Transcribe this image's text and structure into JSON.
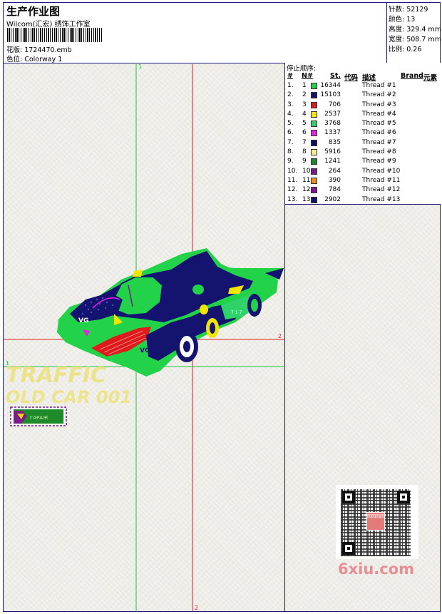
{
  "header": {
    "title": "生产作业图",
    "subtitle": "Wilcom(汇宏) 绣饰工作室",
    "design_line": "花版:  1724470.emb",
    "colorway_line": "色位:  Colorway 1"
  },
  "specs": {
    "stitches": "针数: 52129",
    "colors": "颜色: 13",
    "height": "高度: 329.4 mm",
    "width": "宽度: 508.7 mm",
    "scale": "比例: 0.26"
  },
  "stop_panel": {
    "title": "停止顺序:",
    "headers": {
      "stop": "#",
      "n": "N#",
      "st": "St.",
      "code": "代码",
      "desc": "描述",
      "brand": "Brand",
      "elem": "元素"
    },
    "rows": [
      {
        "stop": "1.",
        "n": "1",
        "color": "#22d34a",
        "st": "16344",
        "desc": "Thread #1"
      },
      {
        "stop": "2.",
        "n": "2",
        "color": "#141470",
        "st": "15103",
        "desc": "Thread #2"
      },
      {
        "stop": "3.",
        "n": "3",
        "color": "#e01a1a",
        "st": "706",
        "desc": "Thread #3"
      },
      {
        "stop": "4.",
        "n": "4",
        "color": "#f2e600",
        "st": "2537",
        "desc": "Thread #4"
      },
      {
        "stop": "5.",
        "n": "5",
        "color": "#2fd36a",
        "st": "3768",
        "desc": "Thread #5"
      },
      {
        "stop": "6.",
        "n": "6",
        "color": "#e81ee8",
        "st": "1337",
        "desc": "Thread #6"
      },
      {
        "stop": "7.",
        "n": "7",
        "color": "#10106a",
        "st": "835",
        "desc": "Thread #7"
      },
      {
        "stop": "8.",
        "n": "8",
        "color": "#f4ef8a",
        "st": "5916",
        "desc": "Thread #8"
      },
      {
        "stop": "9.",
        "n": "9",
        "color": "#1c8a2a",
        "st": "1241",
        "desc": "Thread #9"
      },
      {
        "stop": "10.",
        "n": "10",
        "color": "#7d1a8a",
        "st": "264",
        "desc": "Thread #10"
      },
      {
        "stop": "11.",
        "n": "11",
        "color": "#f08a1a",
        "st": "390",
        "desc": "Thread #11"
      },
      {
        "stop": "12.",
        "n": "12",
        "color": "#82149a",
        "st": "784",
        "desc": "Thread #12"
      },
      {
        "stop": "13.",
        "n": "13",
        "color": "#101862",
        "st": "2902",
        "desc": "Thread #13"
      }
    ]
  },
  "guides": {
    "v1": "1",
    "h2": "2",
    "h1": "1",
    "v2": "2"
  },
  "artwork": {
    "line1": "TRAFFIC",
    "line2": "OLD CAR 001",
    "badge_text": "ГАРАЖ"
  },
  "qr": {
    "stamp": "回回回回"
  },
  "watermark": "6xiu.com"
}
